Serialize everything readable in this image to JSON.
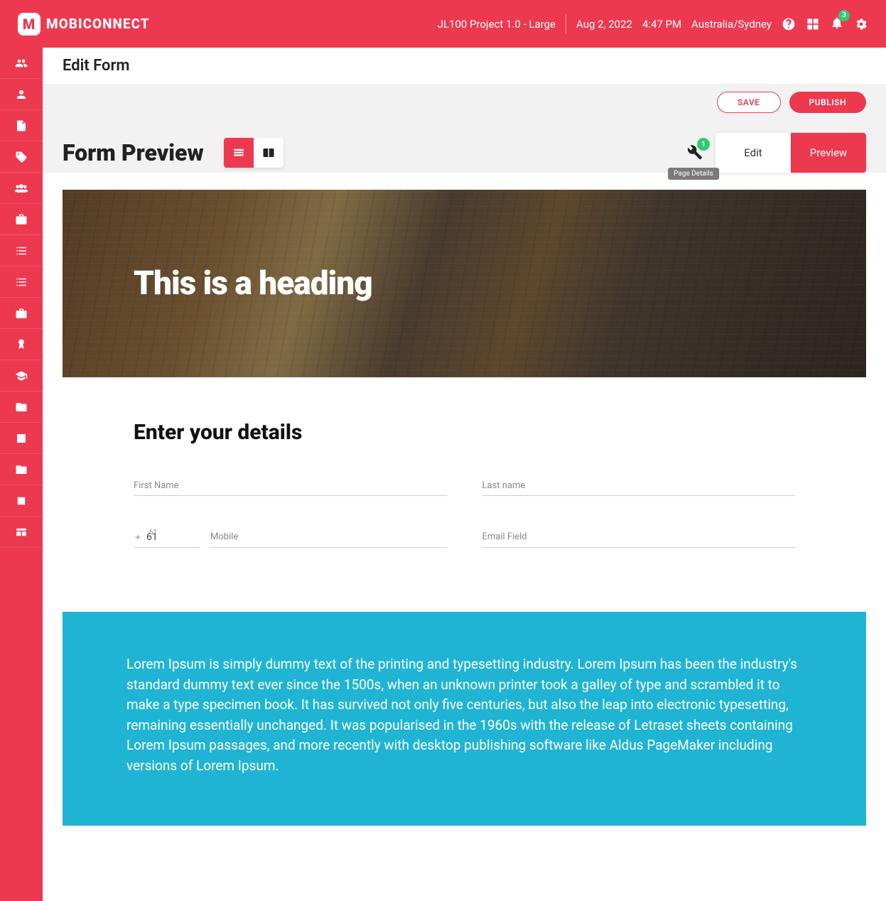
{
  "brand": "MOBICONNECT",
  "header": {
    "project": "JL100 Project 1.0 - Large",
    "date": "Aug 2, 2022",
    "time": "4:47 PM",
    "tz": "Australia/Sydney",
    "notif_count": "3"
  },
  "page": {
    "title": "Edit Form",
    "save": "SAVE",
    "publish": "PUBLISH"
  },
  "preview": {
    "heading": "Form Preview",
    "wrench_badge": "1",
    "tooltip": "Page Details",
    "tab_edit": "Edit",
    "tab_preview": "Preview"
  },
  "hero": {
    "title": "This is a heading"
  },
  "form": {
    "section_title": "Enter your details",
    "first_name": "First Name",
    "last_name": "Last name",
    "cc_small": "61",
    "cc_val": "61",
    "mobile": "Mobile",
    "email": "Email Field"
  },
  "info_text": "Lorem Ipsum is simply dummy text of the printing and typesetting industry. Lorem Ipsum has been the industry's standard dummy text ever since the 1500s, when an unknown printer took a galley of type and scrambled it to make a type specimen book. It has survived not only five centuries, but also the leap into electronic typesetting, remaining essentially unchanged. It was popularised in the 1960s with the release of Letraset sheets containing Lorem Ipsum passages, and more recently with desktop publishing software like Aldus PageMaker including versions of Lorem Ipsum."
}
